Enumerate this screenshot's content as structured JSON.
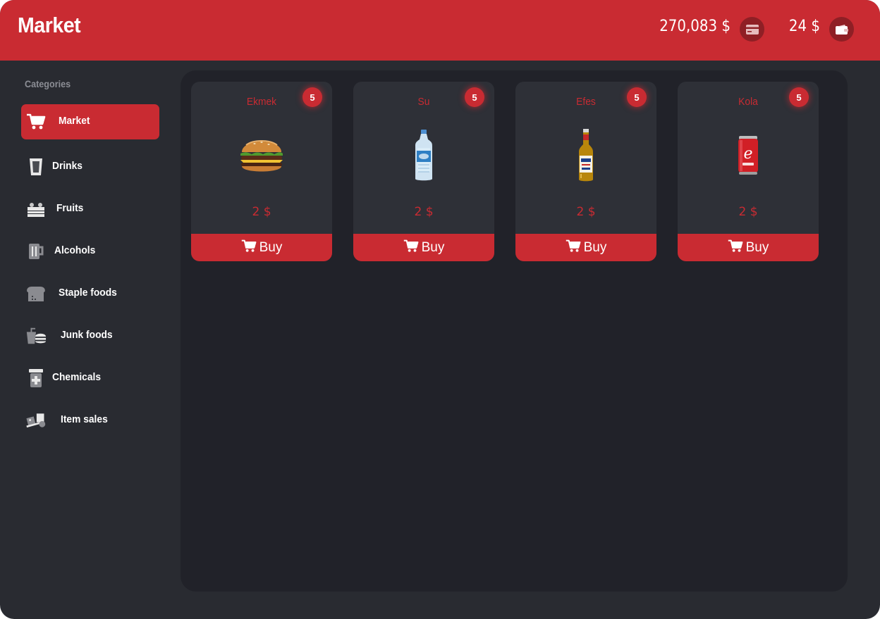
{
  "header": {
    "title": "Market",
    "bank_balance": "270,083 $",
    "cash_balance": "24 $",
    "bank_icon": "credit-card-icon",
    "cash_icon": "wallet-icon"
  },
  "sidebar": {
    "title": "Categories",
    "items": [
      {
        "label": "Market",
        "icon": "cart-icon",
        "active": true
      },
      {
        "label": "Drinks",
        "icon": "glass-icon"
      },
      {
        "label": "Fruits",
        "icon": "fruit-crate-icon"
      },
      {
        "label": "Alcohols",
        "icon": "beer-mug-icon"
      },
      {
        "label": "Staple foods",
        "icon": "bread-icon"
      },
      {
        "label": "Junk foods",
        "icon": "burger-drink-icon"
      },
      {
        "label": "Chemicals",
        "icon": "medicine-jar-icon"
      },
      {
        "label": "Item sales",
        "icon": "hand-truck-icon"
      }
    ]
  },
  "products": [
    {
      "name": "Ekmek",
      "count": "5",
      "price": "2 $",
      "buy_label": "Buy",
      "image": "burger-image"
    },
    {
      "name": "Su",
      "count": "5",
      "price": "2 $",
      "buy_label": "Buy",
      "image": "water-bottle-image"
    },
    {
      "name": "Efes",
      "count": "5",
      "price": "2 $",
      "buy_label": "Buy",
      "image": "beer-bottle-image"
    },
    {
      "name": "Kola",
      "count": "5",
      "price": "2 $",
      "buy_label": "Buy",
      "image": "cola-can-image"
    }
  ],
  "colors": {
    "accent": "#c92b32",
    "background": "#292b31",
    "panel": "#212229",
    "card": "#2e3037"
  }
}
